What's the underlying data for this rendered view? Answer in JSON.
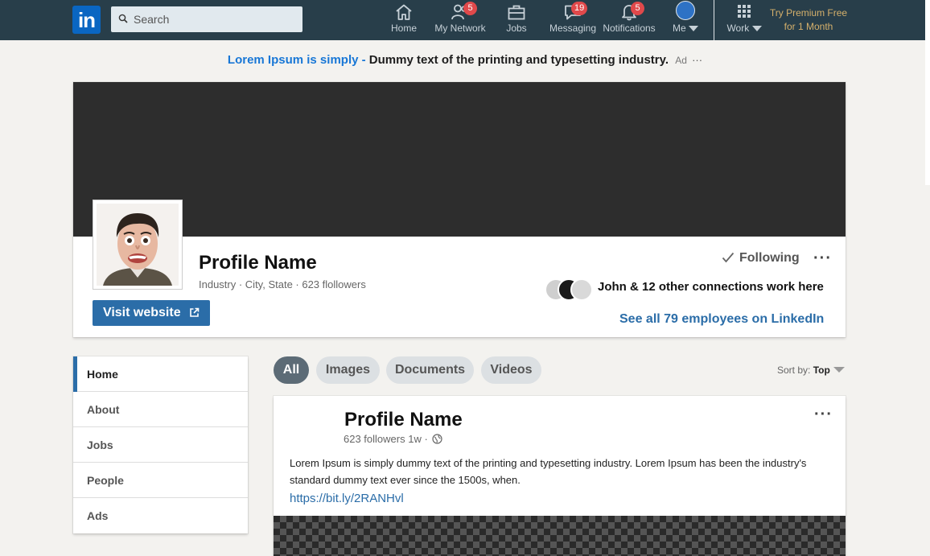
{
  "nav": {
    "logo": "in",
    "search_placeholder": "Search",
    "items": [
      {
        "label": "Home",
        "badge": ""
      },
      {
        "label": "My Network",
        "badge": "5"
      },
      {
        "label": "Jobs",
        "badge": ""
      },
      {
        "label": "Messaging",
        "badge": "19"
      },
      {
        "label": "Notifications",
        "badge": "5"
      },
      {
        "label": "Me",
        "badge": ""
      },
      {
        "label": "Work",
        "badge": ""
      }
    ],
    "premium_line1": "Try Premium Free",
    "premium_line2": "for 1 Month"
  },
  "ad": {
    "link_text": "Lorem Ipsum is simply -",
    "text": "Dummy text of the printing and typesetting industry.",
    "tag": "Ad",
    "more": "···"
  },
  "profile": {
    "name": "Profile Name",
    "meta": "Industry · City, State · 623 flollowers",
    "visit_label": "Visit website",
    "following_label": "Following",
    "connections_text": "John & 12 other connections work here",
    "see_all": "See all 79 employees on LinkedIn",
    "more": "···"
  },
  "sidebar": {
    "items": [
      {
        "label": "Home"
      },
      {
        "label": "About"
      },
      {
        "label": "Jobs"
      },
      {
        "label": "People"
      },
      {
        "label": "Ads"
      }
    ]
  },
  "filters": {
    "pills": [
      "All",
      "Images",
      "Documents",
      "Videos"
    ],
    "sort_label": "Sort by:",
    "sort_value": "Top"
  },
  "post": {
    "name": "Profile Name",
    "meta": "623 followers 1w ·",
    "body": "Lorem Ipsum is simply dummy text of the printing and typesetting industry. Lorem Ipsum has been the industry's standard dummy text ever since the 1500s, when.",
    "link": "https://bit.ly/2RANHvl",
    "more": "···"
  },
  "colors": {
    "nav_bg": "#283e4a",
    "brand_blue": "#0a66c2",
    "link_blue": "#2b6da8",
    "badge_red": "#e0494b",
    "premium_gold": "#d5b06b"
  }
}
